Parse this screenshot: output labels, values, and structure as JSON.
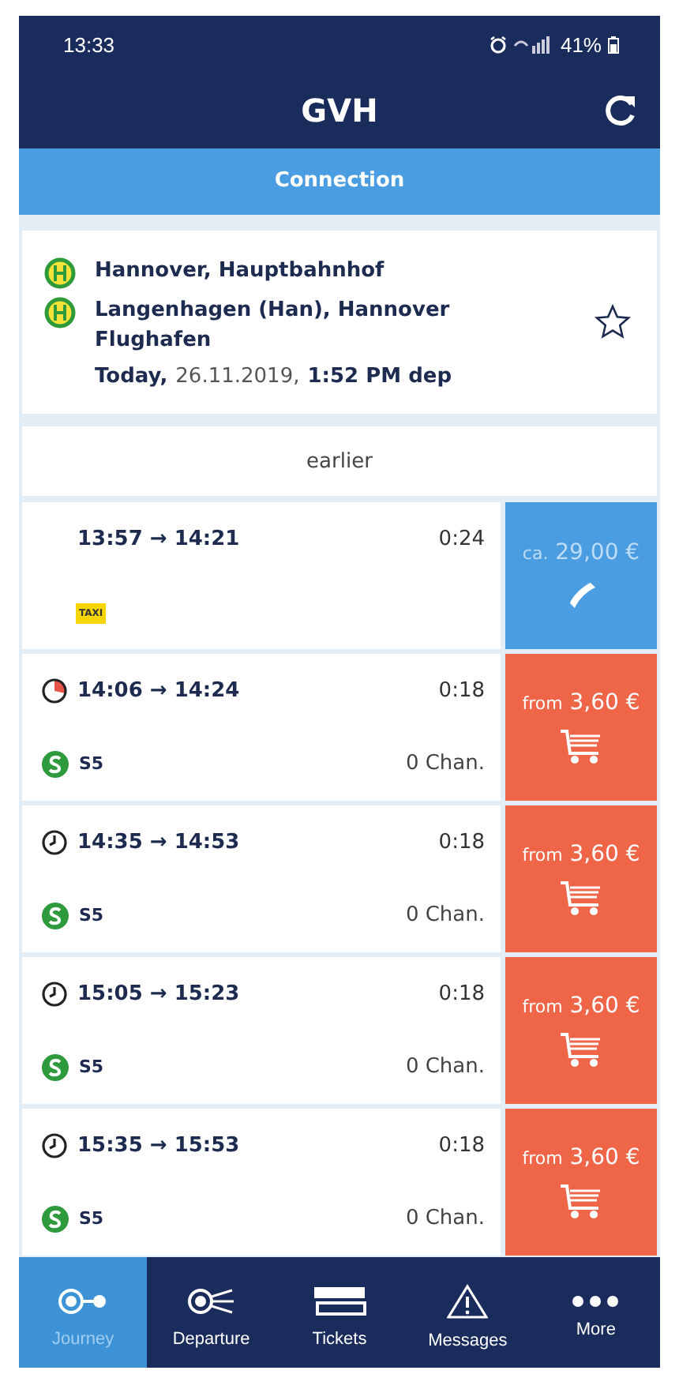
{
  "status_bar": {
    "time": "13:33",
    "battery": "41%"
  },
  "app_bar": {
    "title": "GVH"
  },
  "section_header": {
    "title": "Connection"
  },
  "search": {
    "from": "Hannover, Hauptbahnhof",
    "to": "Langenhagen (Han), Hannover Flughafen",
    "day": "Today,",
    "date": "26.11.2019,",
    "time": "1:52 PM dep",
    "favorite": false
  },
  "earlier": "earlier",
  "connections": [
    {
      "kind": "taxi",
      "times": "13:57 → 14:21",
      "duration": "0:24",
      "badge": "TAXI",
      "price_prefix": "ca.",
      "price": "29,00 €"
    },
    {
      "kind": "train_running",
      "times": "14:06 → 14:24",
      "duration": "0:18",
      "badge": "S5",
      "changes": "0 Chan.",
      "price_prefix": "from",
      "price": "3,60 €"
    },
    {
      "kind": "train",
      "times": "14:35 → 14:53",
      "duration": "0:18",
      "badge": "S5",
      "changes": "0 Chan.",
      "price_prefix": "from",
      "price": "3,60 €"
    },
    {
      "kind": "train",
      "times": "15:05 → 15:23",
      "duration": "0:18",
      "badge": "S5",
      "changes": "0 Chan.",
      "price_prefix": "from",
      "price": "3,60 €"
    },
    {
      "kind": "train",
      "times": "15:35 → 15:53",
      "duration": "0:18",
      "badge": "S5",
      "changes": "0 Chan.",
      "price_prefix": "from",
      "price": "3,60 €"
    }
  ],
  "nav": [
    {
      "label": "Journey",
      "selected": true
    },
    {
      "label": "Departure",
      "selected": false
    },
    {
      "label": "Tickets",
      "selected": false
    },
    {
      "label": "Messages",
      "selected": false
    },
    {
      "label": "More",
      "selected": false
    }
  ]
}
